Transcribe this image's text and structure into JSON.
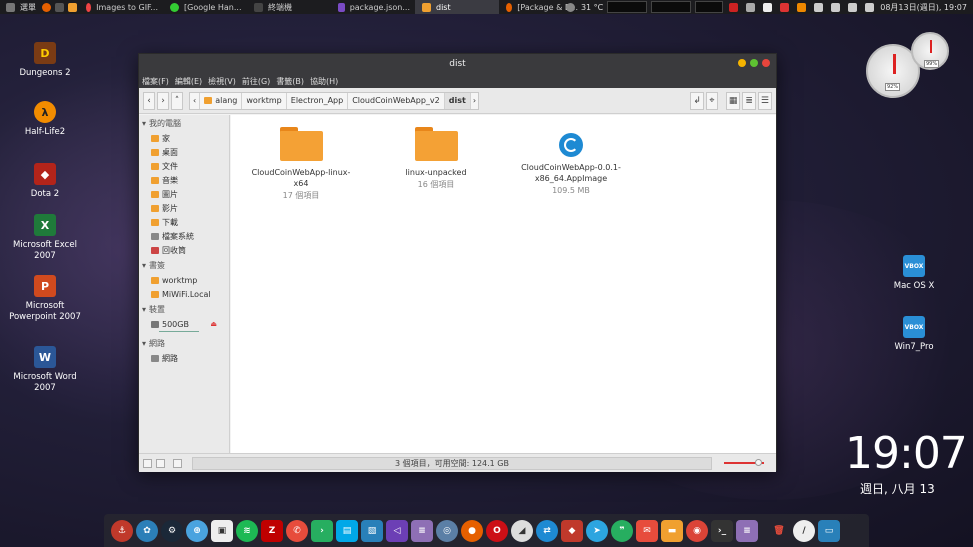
{
  "topbar": {
    "menu_label": "選單",
    "tasks": [
      {
        "label": "Images to GIF..."
      },
      {
        "label": "[Google Han..."
      },
      {
        "label": "終端機"
      },
      {
        "label": "package.json..."
      },
      {
        "label": "dist"
      },
      {
        "label": "[Package & B..."
      }
    ],
    "temperature": "31 °C",
    "datetime": "08月13日(週日), 19:07"
  },
  "desktop_icons_left": [
    {
      "label": "Dungeons 2"
    },
    {
      "label": "Half-Life2"
    },
    {
      "label": "Dota 2"
    },
    {
      "label": "Microsoft Excel 2007"
    },
    {
      "label": "Microsoft Powerpoint 2007"
    },
    {
      "label": "Microsoft Word 2007"
    }
  ],
  "desktop_icons_right": [
    {
      "label": "Mac OS X"
    },
    {
      "label": "Win7_Pro"
    }
  ],
  "window": {
    "title": "dist",
    "menu": [
      "檔案(F)",
      "編輯(E)",
      "檢視(V)",
      "前往(G)",
      "書籤(B)",
      "協助(H)"
    ],
    "breadcrumbs": [
      "alang",
      "worktmp",
      "Electron_App",
      "CloudCoinWebApp_v2",
      "dist"
    ],
    "sidebar": {
      "computer_header": "我的電腦",
      "computer_items": [
        "家",
        "桌面",
        "文件",
        "音樂",
        "圖片",
        "影片",
        "下載",
        "檔案系統",
        "回收筒"
      ],
      "bookmarks_header": "書簽",
      "bookmark_items": [
        "worktmp",
        "MiWiFi.Local"
      ],
      "devices_header": "裝置",
      "device_items": [
        "500GB"
      ],
      "network_header": "網路",
      "network_items": [
        "網路"
      ]
    },
    "files": [
      {
        "name": "CloudCoinWebApp-linux-x64",
        "info": "17 個項目",
        "kind": "folder"
      },
      {
        "name": "linux-unpacked",
        "info": "16 個項目",
        "kind": "folder"
      },
      {
        "name": "CloudCoinWebApp-0.0.1-x86_64.AppImage",
        "info": "109.5 MB",
        "kind": "app"
      }
    ],
    "status": "3 個項目，可用空間: 124.1 GB"
  },
  "gauges": {
    "cpu": "92%",
    "mem": "99%"
  },
  "clock": {
    "time": "19:07",
    "date": "週日, 八月 13"
  },
  "colors": {
    "folder": "#f4a135",
    "accent": "#1e8ad3",
    "titlebar": "#3a3a3d"
  }
}
